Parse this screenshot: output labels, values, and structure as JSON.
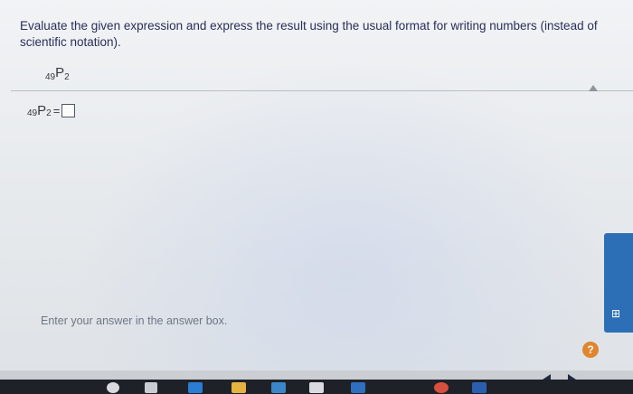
{
  "question": {
    "text": "Evaluate the given expression and express the result using the usual format for writing numbers (instead of scientific notation)."
  },
  "expression": {
    "n": "49",
    "symbol": "P",
    "r": "2"
  },
  "answer": {
    "equals": "=",
    "value": ""
  },
  "hint": {
    "text": "Enter your answer in the answer box."
  },
  "help": {
    "label": "?"
  },
  "colors": {
    "accent": "#2d6fb6",
    "help": "#e0862e",
    "question_text": "#2a2f5a"
  },
  "icons": {
    "side_tab_icon": "grid-icon"
  }
}
